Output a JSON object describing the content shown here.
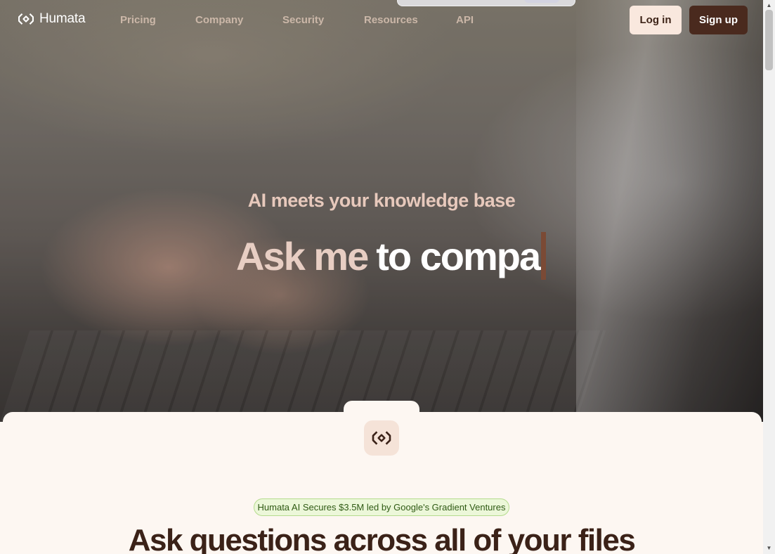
{
  "brand": {
    "name": "Humata",
    "icon": "humata-logo-icon"
  },
  "nav": {
    "links": [
      {
        "label": "Pricing"
      },
      {
        "label": "Company"
      },
      {
        "label": "Security"
      },
      {
        "label": "Resources"
      },
      {
        "label": "API"
      }
    ],
    "login_label": "Log in",
    "signup_label": "Sign up"
  },
  "hero": {
    "tagline": "AI meets your knowledge base",
    "headline_static": "Ask me",
    "headline_typed": "to compa"
  },
  "content": {
    "news_badge": "Humata AI Secures $3.5M led by Google's Gradient Ventures",
    "title": "Ask questions across all of your files"
  },
  "colors": {
    "accent": "#4a2a1e",
    "login_bg": "#f9e8de",
    "badge_bg": "#ecf7d9",
    "caret": "#7b4a35"
  }
}
